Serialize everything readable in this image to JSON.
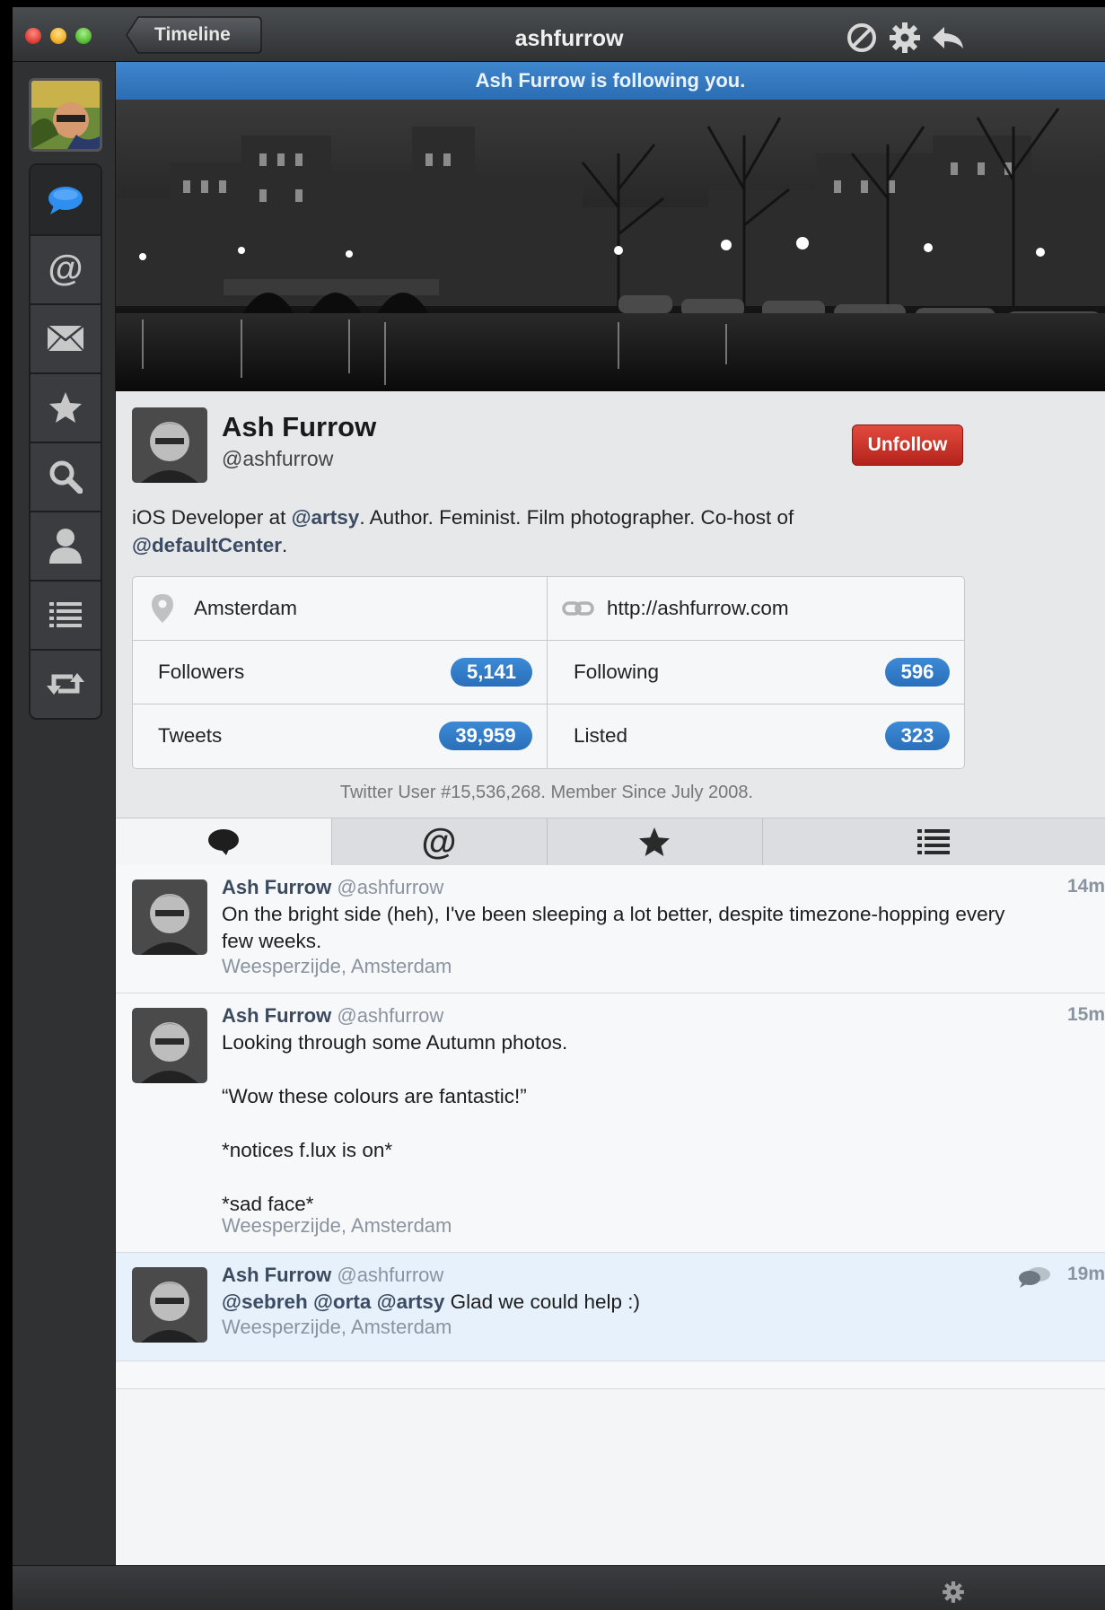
{
  "window": {
    "title": "ashfurrow",
    "back_label": "Timeline",
    "toolbar_icons": [
      "block-icon",
      "gear-icon",
      "reply-icon"
    ]
  },
  "sidebar": {
    "items": [
      {
        "name": "timeline",
        "icon": "speech-bubble-icon",
        "active": true
      },
      {
        "name": "mentions",
        "icon": "at-icon"
      },
      {
        "name": "messages",
        "icon": "envelope-icon"
      },
      {
        "name": "favorites",
        "icon": "star-icon"
      },
      {
        "name": "search",
        "icon": "magnifier-icon"
      },
      {
        "name": "profile",
        "icon": "person-icon"
      },
      {
        "name": "lists",
        "icon": "list-icon"
      },
      {
        "name": "retweets",
        "icon": "retweet-icon"
      }
    ]
  },
  "banner": "Ash Furrow is following you.",
  "profile": {
    "name": "Ash Furrow",
    "handle": "@ashfurrow",
    "unfollow_label": "Unfollow",
    "bio_pre": "iOS Developer at ",
    "bio_mention1": "@artsy",
    "bio_mid": ". Author. Feminist. Film photographer. Co-host of",
    "bio_mention2": "@defaultCenter",
    "bio_post": ".",
    "location": "Amsterdam",
    "url": "http://ashfurrow.com",
    "stats": {
      "followers_label": "Followers",
      "followers": "5,141",
      "following_label": "Following",
      "following": "596",
      "tweets_label": "Tweets",
      "tweets": "39,959",
      "listed_label": "Listed",
      "listed": "323"
    },
    "member_line": "Twitter User #15,536,268. Member Since July 2008."
  },
  "tabs": [
    "tweets-tab",
    "mentions-tab",
    "favorites-tab",
    "lists-tab"
  ],
  "tweets": [
    {
      "name": "Ash Furrow",
      "handle": "@ashfurrow",
      "time": "14m",
      "body": "On the bright side (heh), I've been sleeping a lot better, despite timezone-hopping every few weeks.",
      "location": "Weesperzijde, Amsterdam"
    },
    {
      "name": "Ash Furrow",
      "handle": "@ashfurrow",
      "time": "15m",
      "body": "Looking through some Autumn photos.\n\n“Wow these colours are fantastic!”\n\n*notices f.lux is on*\n\n*sad face*",
      "location": "Weesperzijde, Amsterdam"
    },
    {
      "name": "Ash Furrow",
      "handle": "@ashfurrow",
      "time": "19m",
      "mentions": "@sebreh @orta @artsy",
      "body": " Glad we could help :)",
      "location": "Weesperzijde, Amsterdam"
    }
  ],
  "colors": {
    "accent": "#2c6db3",
    "unfollow": "#c8302a",
    "highlight": "#e6f1fb"
  }
}
